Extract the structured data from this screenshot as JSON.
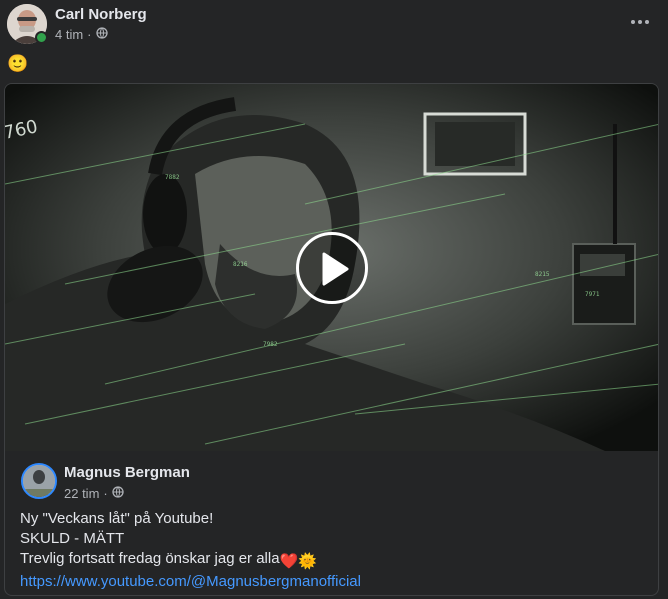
{
  "post": {
    "author": "Carl Norberg",
    "time": "4 tim",
    "separator": "·",
    "privacy_icon": "globe-icon",
    "more_icon": "more-options-icon",
    "text_emoji": "🙂"
  },
  "shared": {
    "author": "Magnus Bergman",
    "time": "22 tim",
    "separator": "·",
    "privacy_icon": "globe-icon",
    "line1": "Ny \"Veckans låt\" på Youtube!",
    "line2": "SKULD - MÄTT",
    "line3": "Trevlig fortsatt fredag önskar jag er alla",
    "line3_emojis": "❤️🌞",
    "link": "https://www.youtube.com/@Magnusbergmanofficial",
    "video": {
      "play_icon": "play-icon",
      "overlay_labels": [
        "760",
        "8216",
        "7982",
        "8215",
        "7971",
        "7882"
      ]
    }
  },
  "colors": {
    "background": "#242526",
    "text": "#e4e6eb",
    "muted": "#b0b3b8",
    "link": "#4599ff",
    "online": "#31a24c"
  }
}
